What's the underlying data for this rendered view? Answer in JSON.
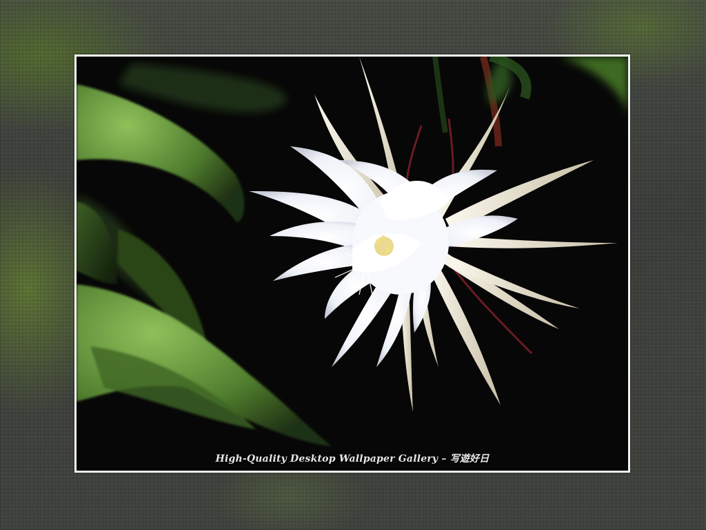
{
  "wallpaper": {
    "caption": "High-Quality Desktop Wallpaper Gallery – 写遊好日",
    "subject": "white night-blooming cactus flower with green leaves",
    "colors": {
      "frame_border": "#f3f3f3",
      "photo_background": "#070707",
      "leaf_green": "#5f8f3a",
      "petal_white": "#f4f6fb",
      "stamen_yellow": "#e6d27a"
    }
  }
}
